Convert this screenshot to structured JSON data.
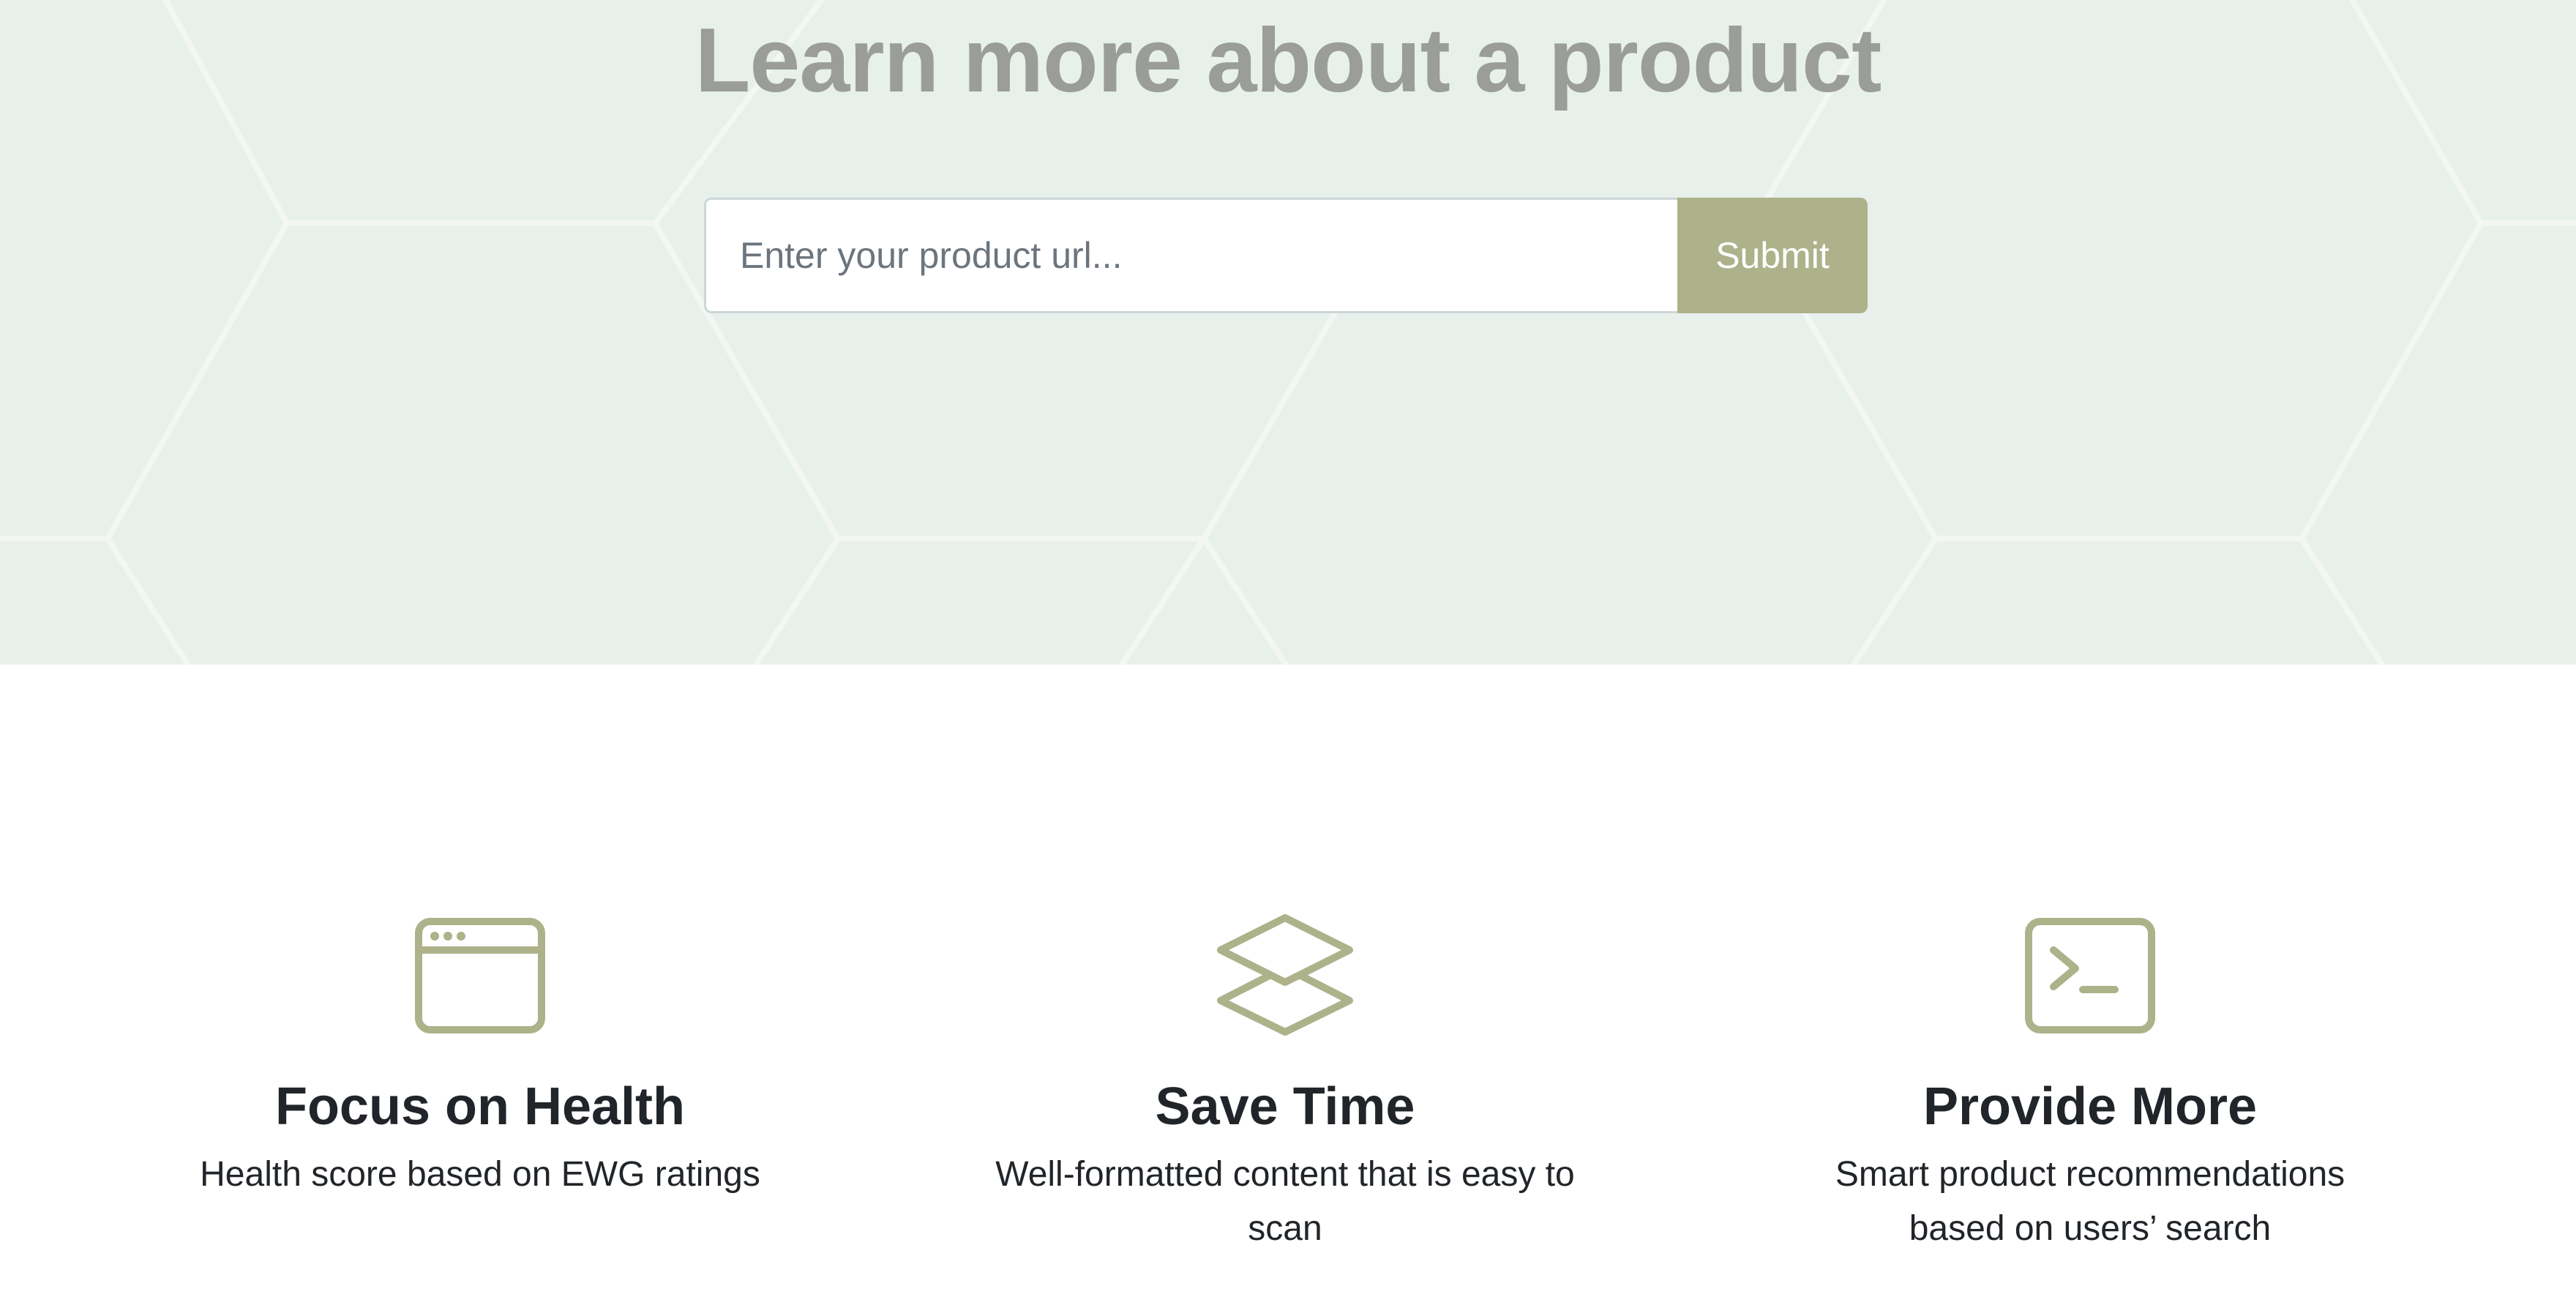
{
  "hero": {
    "title": "Learn more about a product",
    "search": {
      "placeholder": "Enter your product url...",
      "value": "",
      "submit_label": "Submit"
    }
  },
  "features": [
    {
      "icon": "browser-window-icon",
      "title": "Focus on Health",
      "text": "Health score based on EWG ratings"
    },
    {
      "icon": "layers-icon",
      "title": "Save Time",
      "text": "Well-formatted content that is easy to scan"
    },
    {
      "icon": "terminal-icon",
      "title": "Provide More",
      "text": "Smart product recommendations based on users’ search"
    }
  ],
  "colors": {
    "hero_background": "#e8f0ec",
    "accent": "#adb28a",
    "title_gray": "#9a9d98",
    "text_dark": "#212529"
  }
}
